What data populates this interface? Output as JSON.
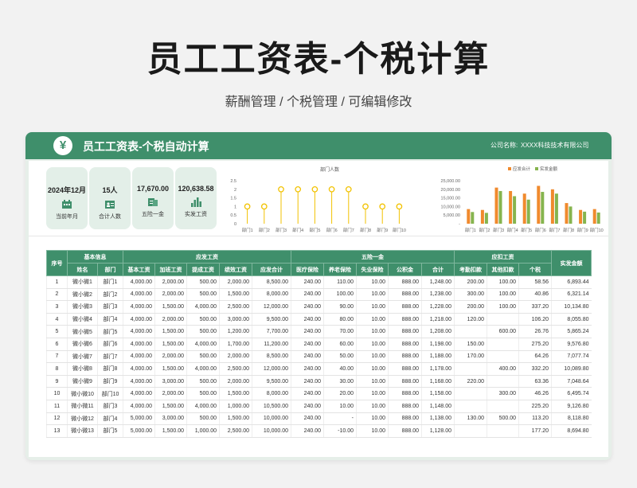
{
  "hero": {
    "title": "员工工资表-个税计算",
    "subtitle": "薪酬管理 / 个税管理 / 可编辑修改"
  },
  "header": {
    "yen": "¥",
    "title": "员工工资表-个税自动计算",
    "company_label": "公司名称:",
    "company_value": "XXXX科技技术有限公司"
  },
  "stats": [
    {
      "value": "2024年12月",
      "label": "当前年月",
      "icon": "calendar-icon"
    },
    {
      "value": "15人",
      "label": "合计人数",
      "icon": "people-icon"
    },
    {
      "value": "17,670.00",
      "label": "五险一金",
      "icon": "document-icon"
    },
    {
      "value": "120,638.58",
      "label": "实发工资",
      "icon": "bar-chart-icon"
    }
  ],
  "chart_data": [
    {
      "type": "line",
      "title": "部门人数",
      "categories": [
        "部门1",
        "部门2",
        "部门3",
        "部门4",
        "部门5",
        "部门6",
        "部门7",
        "部门8",
        "部门9",
        "部门10"
      ],
      "values": [
        1,
        1,
        2,
        2,
        2,
        2,
        2,
        1,
        1,
        1
      ],
      "yticks": [
        "2.5",
        "2",
        "1.5",
        "1",
        "0.5",
        "0"
      ],
      "ylim": [
        0,
        2.5
      ],
      "color": "#f2c200"
    },
    {
      "type": "bar",
      "title": "",
      "categories": [
        "部门1",
        "部门2",
        "部门3",
        "部门4",
        "部门5",
        "部门6",
        "部门7",
        "部门8",
        "部门9",
        "部门10"
      ],
      "yticks": [
        "25,000.00",
        "20,000.00",
        "15,000.00",
        "10,000.00",
        "5,000.00",
        "-"
      ],
      "ylim": [
        0,
        25000
      ],
      "series": [
        {
          "name": "应发合计",
          "color": "#f08a2d",
          "values": [
            8500,
            8000,
            21000,
            19000,
            17500,
            22000,
            20000,
            12000,
            8000,
            8500
          ]
        },
        {
          "name": "实发金额",
          "color": "#86b44e",
          "values": [
            6800,
            6300,
            19000,
            16000,
            14000,
            18500,
            17500,
            10000,
            7000,
            6500
          ]
        }
      ]
    }
  ],
  "table": {
    "group_headers": {
      "seq": "序号",
      "basic": "基本信息",
      "payable": "应发工资",
      "insurance": "五险一金",
      "deduction": "应扣工资",
      "net": "实发金额"
    },
    "columns": [
      "姓名",
      "部门",
      "基本工资",
      "加班工资",
      "提成工资",
      "绩效工资",
      "应发合计",
      "医疗保险",
      "养老保险",
      "失业保险",
      "公积金",
      "合计",
      "考勤扣款",
      "其他扣款",
      "个税"
    ],
    "rows": [
      [
        "1",
        "微小微1",
        "部门1",
        "4,000.00",
        "2,000.00",
        "500.00",
        "2,000.00",
        "8,500.00",
        "240.00",
        "110.00",
        "10.00",
        "888.00",
        "1,248.00",
        "200.00",
        "100.00",
        "58.56",
        "6,893.44"
      ],
      [
        "2",
        "微小微2",
        "部门2",
        "4,000.00",
        "2,000.00",
        "500.00",
        "1,500.00",
        "8,000.00",
        "240.00",
        "100.00",
        "10.00",
        "888.00",
        "1,238.00",
        "300.00",
        "100.00",
        "40.86",
        "6,321.14"
      ],
      [
        "3",
        "微小微3",
        "部门3",
        "4,000.00",
        "1,500.00",
        "4,000.00",
        "2,500.00",
        "12,000.00",
        "240.00",
        "90.00",
        "10.00",
        "888.00",
        "1,228.00",
        "200.00",
        "100.00",
        "337.20",
        "10,134.80"
      ],
      [
        "4",
        "微小微4",
        "部门4",
        "4,000.00",
        "2,000.00",
        "500.00",
        "3,000.00",
        "9,500.00",
        "240.00",
        "80.00",
        "10.00",
        "888.00",
        "1,218.00",
        "120.00",
        "",
        "106.20",
        "8,055.80"
      ],
      [
        "5",
        "微小微5",
        "部门5",
        "4,000.00",
        "1,500.00",
        "500.00",
        "1,200.00",
        "7,700.00",
        "240.00",
        "70.00",
        "10.00",
        "888.00",
        "1,208.00",
        "",
        "600.00",
        "26.76",
        "5,865.24"
      ],
      [
        "6",
        "微小微6",
        "部门6",
        "4,000.00",
        "1,500.00",
        "4,000.00",
        "1,700.00",
        "11,200.00",
        "240.00",
        "60.00",
        "10.00",
        "888.00",
        "1,198.00",
        "150.00",
        "",
        "275.20",
        "9,576.80"
      ],
      [
        "7",
        "微小微7",
        "部门7",
        "4,000.00",
        "2,000.00",
        "500.00",
        "2,000.00",
        "8,500.00",
        "240.00",
        "50.00",
        "10.00",
        "888.00",
        "1,188.00",
        "170.00",
        "",
        "64.26",
        "7,077.74"
      ],
      [
        "8",
        "微小微8",
        "部门8",
        "4,000.00",
        "1,500.00",
        "4,000.00",
        "2,500.00",
        "12,000.00",
        "240.00",
        "40.00",
        "10.00",
        "888.00",
        "1,178.00",
        "",
        "400.00",
        "332.20",
        "10,089.80"
      ],
      [
        "9",
        "微小微9",
        "部门9",
        "4,000.00",
        "3,000.00",
        "500.00",
        "2,000.00",
        "9,500.00",
        "240.00",
        "30.00",
        "10.00",
        "888.00",
        "1,168.00",
        "220.00",
        "",
        "63.36",
        "7,048.64"
      ],
      [
        "10",
        "微小微10",
        "部门10",
        "4,000.00",
        "2,000.00",
        "500.00",
        "1,500.00",
        "8,000.00",
        "240.00",
        "20.00",
        "10.00",
        "888.00",
        "1,158.00",
        "",
        "300.00",
        "46.26",
        "6,495.74"
      ],
      [
        "11",
        "微小微11",
        "部门3",
        "4,000.00",
        "1,500.00",
        "4,000.00",
        "1,000.00",
        "10,500.00",
        "240.00",
        "10.00",
        "10.00",
        "888.00",
        "1,148.00",
        "",
        "",
        "225.20",
        "9,126.80"
      ],
      [
        "12",
        "微小微12",
        "部门4",
        "5,000.00",
        "3,000.00",
        "500.00",
        "1,500.00",
        "10,000.00",
        "240.00",
        "-",
        "10.00",
        "888.00",
        "1,138.00",
        "130.00",
        "500.00",
        "113.20",
        "8,118.80"
      ],
      [
        "13",
        "微小微13",
        "部门5",
        "5,000.00",
        "1,500.00",
        "1,000.00",
        "2,500.00",
        "10,000.00",
        "240.00",
        "-10.00",
        "10.00",
        "888.00",
        "1,128.00",
        "",
        "",
        "177.20",
        "8,694.80"
      ]
    ]
  }
}
